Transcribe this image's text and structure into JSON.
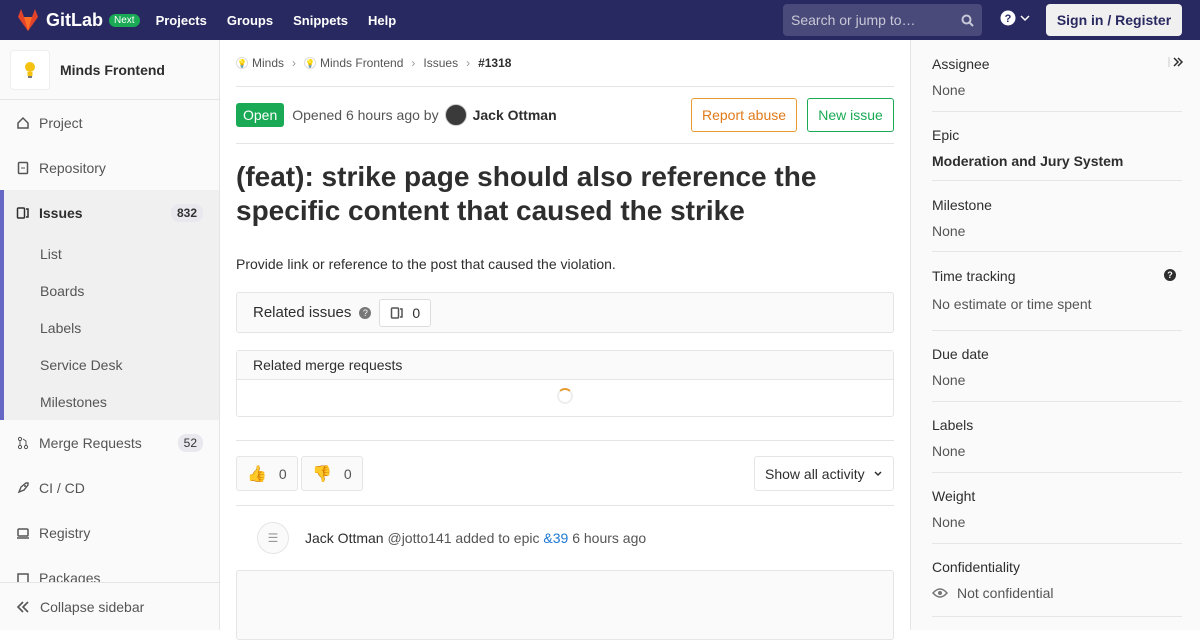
{
  "topbar": {
    "brand": "GitLab",
    "badge": "Next",
    "nav": [
      "Projects",
      "Groups",
      "Snippets",
      "Help"
    ],
    "search_placeholder": "Search or jump to…",
    "signin": "Sign in / Register"
  },
  "sidebar": {
    "project_name": "Minds Frontend",
    "items": [
      {
        "label": "Project",
        "icon": "home-icon"
      },
      {
        "label": "Repository",
        "icon": "doc-icon"
      },
      {
        "label": "Issues",
        "icon": "issues-icon",
        "count": "832"
      },
      {
        "label": "Merge Requests",
        "icon": "merge-icon",
        "count": "52"
      },
      {
        "label": "CI / CD",
        "icon": "rocket-icon"
      },
      {
        "label": "Registry",
        "icon": "disk-icon"
      },
      {
        "label": "Packages",
        "icon": "package-icon"
      }
    ],
    "subitems": [
      "List",
      "Boards",
      "Labels",
      "Service Desk",
      "Milestones"
    ],
    "collapse": "Collapse sidebar"
  },
  "breadcrumb": [
    "Minds",
    "Minds Frontend",
    "Issues",
    "#1318"
  ],
  "issue": {
    "status": "Open",
    "opened": "Opened 6 hours ago by",
    "author": "Jack Ottman",
    "report_abuse": "Report abuse",
    "new_issue": "New issue",
    "title": "(feat): strike page should also reference the specific content that caused the strike",
    "description": "Provide link or reference to the post that caused the violation.",
    "related_issues_label": "Related issues",
    "related_issues_count": "0",
    "related_mr_label": "Related merge requests",
    "thumbs_up": "0",
    "thumbs_down": "0",
    "show_all": "Show all activity",
    "event": {
      "name": "Jack Ottman",
      "handle": "@jotto141",
      "action": "added to epic",
      "epic": "&39",
      "time": "6 hours ago"
    }
  },
  "right": {
    "assignee_label": "Assignee",
    "assignee": "None",
    "epic_label": "Epic",
    "epic": "Moderation and Jury System",
    "milestone_label": "Milestone",
    "milestone": "None",
    "time_label": "Time tracking",
    "time": "No estimate or time spent",
    "due_label": "Due date",
    "due": "None",
    "labels_label": "Labels",
    "labels": "None",
    "weight_label": "Weight",
    "weight": "None",
    "conf_label": "Confidentiality",
    "conf": "Not confidential"
  }
}
